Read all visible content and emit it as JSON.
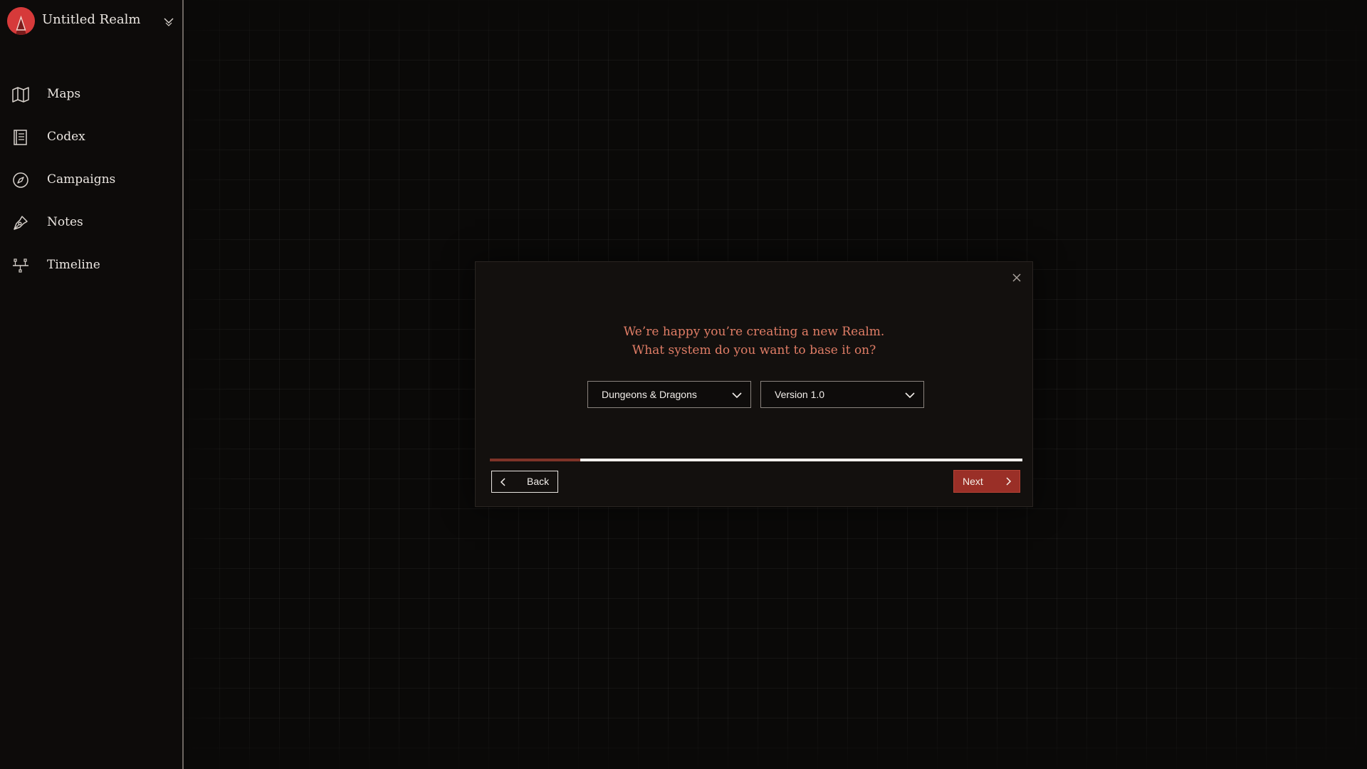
{
  "realm": {
    "name": "Untitled Realm",
    "logo_icon": "realm-logo-icon",
    "switcher_icon": "chevron-down-icon"
  },
  "sidebar": {
    "items": [
      {
        "id": "maps",
        "label": "Maps",
        "icon": "map-icon"
      },
      {
        "id": "codex",
        "label": "Codex",
        "icon": "book-icon"
      },
      {
        "id": "campaigns",
        "label": "Campaigns",
        "icon": "compass-icon"
      },
      {
        "id": "notes",
        "label": "Notes",
        "icon": "pen-nib-icon"
      },
      {
        "id": "timeline",
        "label": "Timeline",
        "icon": "timeline-icon"
      }
    ]
  },
  "modal": {
    "prompt_line1": "We’re happy you’re creating a new Realm.",
    "prompt_line2": "What system do you want to base it on?",
    "system_select": {
      "value": "Dungeons & Dragons"
    },
    "version_select": {
      "value": "Version 1.0"
    },
    "progress": 0.17,
    "back_label": "Back",
    "next_label": "Next",
    "close_icon": "close-icon"
  },
  "colors": {
    "accent": "#d63a3a",
    "prompt_text": "#e07d66",
    "next_button": "#9a2f27",
    "progress_fill": "#7f3328",
    "progress_track": "#f2efec",
    "background": "#0a0908"
  }
}
